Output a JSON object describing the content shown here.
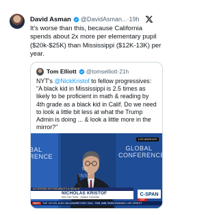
{
  "tweet": {
    "author_name": "David Asman",
    "handle": "@DavidAsman...",
    "separator": "·",
    "time": "19h",
    "text": "It's worse than this, because California spends about 2x more per elementary pupil ($20k-$25K) than Mississippi ($12K-13K) per year."
  },
  "quoted_tweet": {
    "author_name": "Tom Elliott",
    "handle": "@tomselliott",
    "separator": "·",
    "time": "21h",
    "text_before_mention": "NYT's ",
    "mention": "@NickKristof",
    "text_after_mention": " to fellow progressives: \"A black kid in Mississippi is 2.5 times as likely to be proficient in math & reading by 4th grade as a black kid in Calif. Do we need to look a little bit less at what the Trump Admin is doing ... & look a little more in the mirror?\""
  },
  "media": {
    "conference_left": "BAL\nRENCE",
    "conference_right": "GLOBAL\nCONFERENCE",
    "conference_mid": "MI\nINST",
    "live_badge": "LOS ANGELES",
    "topic": "ACCESSING AFFORDABILITY & HEALTH",
    "speaker_name": "NICHOLAS KRISTOF",
    "speaker_title": "New York Times  ·  Opinion Columnist",
    "network": "C-SPAN",
    "live_label": "LIVE",
    "ticker_tag": "NEXT",
    "ticker_text": "TUE. 1/4 9:00, ALSO: BILLIONAIRE EXEC TALK - FMR. AMB. RAHM EMANUEL  LIVE 12PM ET"
  },
  "colors": {
    "verified": "#1d9bf0",
    "link": "#1d9bf0",
    "muted_text": "#536471",
    "border": "#cfd9de"
  },
  "icons": {
    "verified": "verified-badge-icon",
    "logo": "x-logo-icon"
  }
}
